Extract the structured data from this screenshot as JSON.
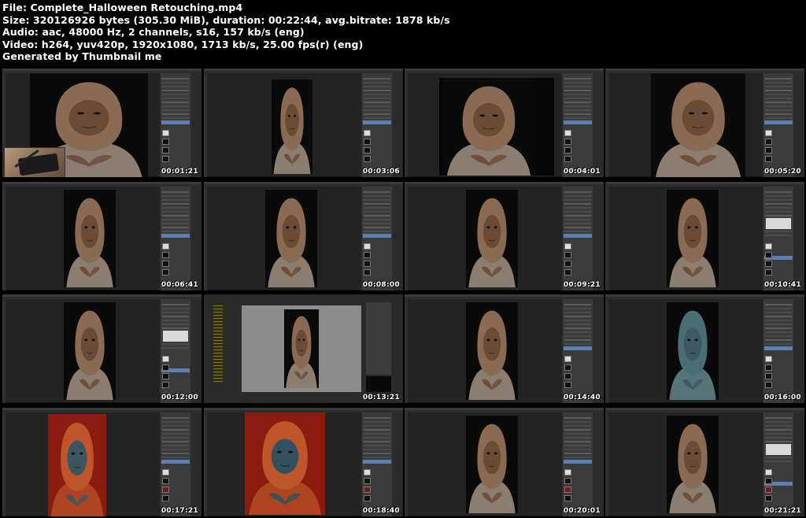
{
  "header": {
    "line1": "File: Complete_Halloween Retouching.mp4",
    "line2": "Size: 320126926 bytes (305.30 MiB), duration: 00:22:44, avg.bitrate: 1878 kb/s",
    "line3": "Audio: aac, 48000 Hz, 2 channels, s16, 157 kb/s (eng)",
    "line4": "Video: h264, yuv420p, 1920x1080, 1713 kb/s, 25.00 fps(r) (eng)",
    "line5": "Generated by Thumbnail me"
  },
  "thumbnails": [
    {
      "timestamp": "00:01:21",
      "scene": "closeup-hands",
      "panel": "tools"
    },
    {
      "timestamp": "00:03:06",
      "scene": "portrait-small",
      "panel": "layers"
    },
    {
      "timestamp": "00:04:01",
      "scene": "face-zoom",
      "panel": "layers"
    },
    {
      "timestamp": "00:05:20",
      "scene": "face-wide",
      "panel": "layers"
    },
    {
      "timestamp": "00:06:41",
      "scene": "portrait",
      "panel": "layers"
    },
    {
      "timestamp": "00:08:00",
      "scene": "portrait",
      "panel": "layers"
    },
    {
      "timestamp": "00:09:21",
      "scene": "portrait",
      "panel": "layers"
    },
    {
      "timestamp": "00:10:41",
      "scene": "portrait",
      "panel": "curves"
    },
    {
      "timestamp": "00:12:00",
      "scene": "portrait",
      "panel": "curves"
    },
    {
      "timestamp": "00:13:21",
      "scene": "file-browser",
      "panel": "browser"
    },
    {
      "timestamp": "00:14:40",
      "scene": "portrait",
      "panel": "layers"
    },
    {
      "timestamp": "00:16:00",
      "scene": "portrait-teal",
      "panel": "layers"
    },
    {
      "timestamp": "00:17:21",
      "scene": "portrait-red",
      "panel": "layers"
    },
    {
      "timestamp": "00:18:40",
      "scene": "portrait-red-blue",
      "panel": "layers"
    },
    {
      "timestamp": "00:20:01",
      "scene": "portrait",
      "panel": "layers"
    },
    {
      "timestamp": "00:21:21",
      "scene": "portrait",
      "panel": "curves"
    }
  ],
  "colors": {
    "background": "#000000",
    "header_text": "#ffffff",
    "workspace": "#232323",
    "panel": "#3b3b3b",
    "selection": "#5b7fb0",
    "skin": "#6b4a36",
    "scarf": "#8a6a52",
    "teal": "#3e5f66",
    "red": "#8c1a0e"
  }
}
